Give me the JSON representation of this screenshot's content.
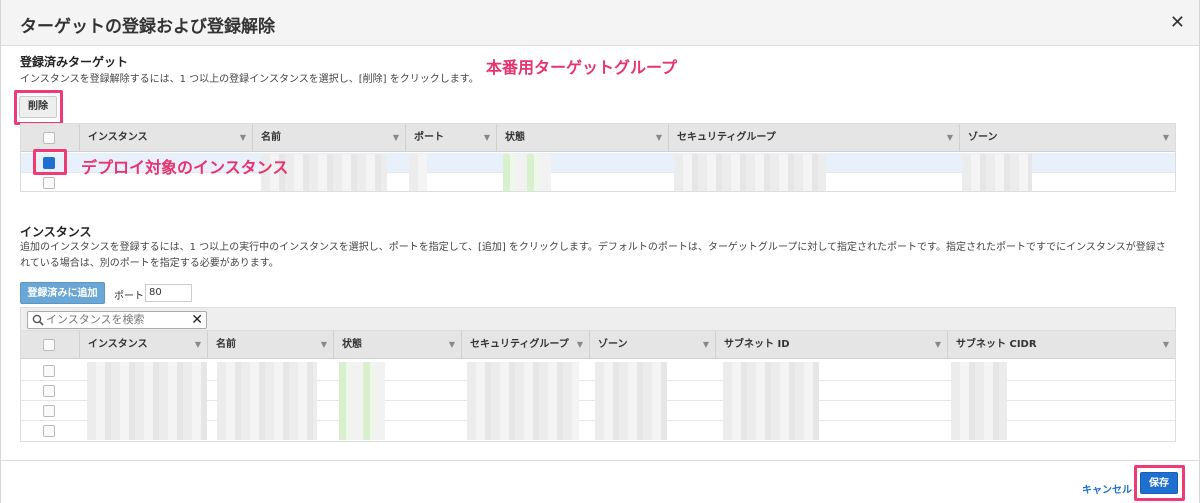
{
  "dialog": {
    "title": "ターゲットの登録および登録解除",
    "close_icon": "close-icon"
  },
  "registered": {
    "title": "登録済みターゲット",
    "description": "インスタンスを登録解除するには、1 つ以上の登録インスタンスを選択し、[削除] をクリックします。",
    "remove_label": "削除",
    "columns": [
      "インスタンス",
      "名前",
      "ポート",
      "状態",
      "セキュリティグループ",
      "ゾーン"
    ],
    "rows": [
      {
        "checked": true
      },
      {
        "checked": false
      }
    ]
  },
  "annotations": {
    "group": "本番用ターゲットグループ",
    "instance": "デプロイ対象のインスタンス"
  },
  "instances": {
    "title": "インスタンス",
    "description": "追加のインスタンスを登録するには、1 つ以上の実行中のインスタンスを選択し、ポートを指定して、[追加] をクリックします。デフォルトのポートは、ターゲットグループに対して指定されたポートです。指定されたポートですでにインスタンスが登録されている場合は、別のポートを指定する必要があります。",
    "add_label": "登録済みに追加",
    "port_label": "ポート",
    "port_value": "80",
    "search_placeholder": "インスタンスを検索",
    "columns": [
      "インスタンス",
      "名前",
      "状態",
      "セキュリティグループ",
      "ゾーン",
      "サブネット ID",
      "サブネット CIDR"
    ],
    "rows": [
      {},
      {},
      {},
      {}
    ]
  },
  "footer": {
    "cancel_label": "キャンセル",
    "save_label": "保存"
  },
  "colors": {
    "annotation": "#e8336f",
    "primary": "#1f6fd1"
  }
}
